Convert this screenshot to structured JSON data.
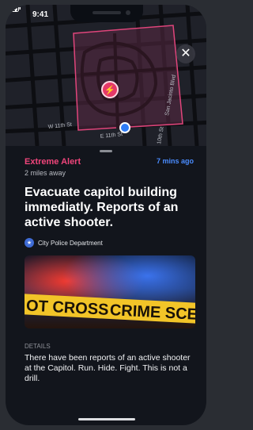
{
  "status_bar": {
    "time": "9:41",
    "signal_icon": "signal-icon",
    "wifi_icon": "wifi-icon",
    "battery_icon": "battery-icon"
  },
  "map": {
    "street_labels": [
      "W 11th St",
      "E 11th St",
      "San Jacinto Blvd",
      "10th St"
    ],
    "alert_pin_icon": "bolt-icon",
    "close_icon": "close-icon",
    "zone_color": "#e0457b"
  },
  "alert": {
    "severity": "Extreme Alert",
    "time_ago": "7 mins ago",
    "distance": "2 miles away",
    "headline": "Evacuate capitol building immediatly. Reports of an active shooter.",
    "source": "City Police Department",
    "scene_tape_left": "OT CROSS",
    "scene_tape_right": "CRIME SCEN",
    "details_heading": "DETAILS",
    "details_body": "There have been reports of an active shooter at the Capitol. Run. Hide. Fight. This is not a drill."
  },
  "colors": {
    "accent_pink": "#f0457b",
    "link_blue": "#4a8cff",
    "background": "#12151c"
  }
}
